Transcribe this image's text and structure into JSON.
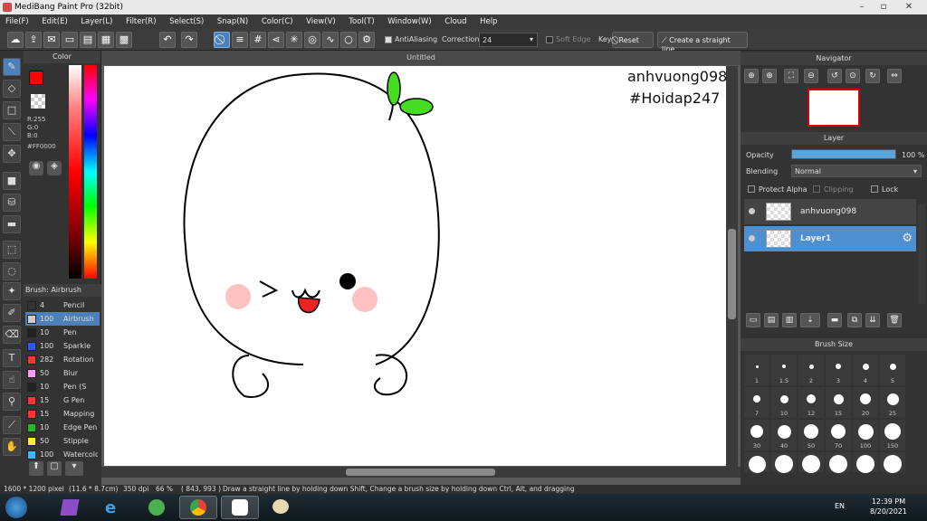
{
  "window": {
    "title": "MediBang Paint Pro (32bit)"
  },
  "menu": [
    "File(F)",
    "Edit(E)",
    "Layer(L)",
    "Filter(R)",
    "Select(S)",
    "Snap(N)",
    "Color(C)",
    "View(V)",
    "Tool(T)",
    "Window(W)",
    "Cloud",
    "Help"
  ],
  "toolbar": {
    "antialiasing_label": "AntiAliasing",
    "correction_label": "Correction",
    "correction_value": "24",
    "soft_edge_label": "Soft Edge",
    "key_label": "Key",
    "reset_label": "Reset",
    "straight_line_label": "Create a straight line"
  },
  "color_panel": {
    "title": "Color",
    "primary_color": "#FF0000",
    "r": "R:255",
    "g": "G:0",
    "b": "B:0",
    "hex": "#FF0000"
  },
  "brush_panel": {
    "title": "Brush: Airbrush",
    "brushes": [
      {
        "size": "4",
        "name": "Pencil",
        "color": "#333333"
      },
      {
        "size": "100",
        "name": "Airbrush",
        "color": "#cccccc"
      },
      {
        "size": "10",
        "name": "Pen",
        "color": "#222222"
      },
      {
        "size": "100",
        "name": "Sparkle",
        "color": "#3355ff"
      },
      {
        "size": "282",
        "name": "Rotation",
        "color": "#ff3333"
      },
      {
        "size": "50",
        "name": "Blur",
        "color": "#ff99ff"
      },
      {
        "size": "10",
        "name": "Pen (S",
        "color": "#222222"
      },
      {
        "size": "15",
        "name": "G Pen",
        "color": "#ff3333"
      },
      {
        "size": "15",
        "name": "Mapping",
        "color": "#ff3333"
      },
      {
        "size": "10",
        "name": "Edge Pen",
        "color": "#22bb22"
      },
      {
        "size": "50",
        "name": "Stipple",
        "color": "#ffee22"
      },
      {
        "size": "100",
        "name": "Watercolor",
        "color": "#33bbff"
      }
    ]
  },
  "canvas": {
    "tab_title": "Untitled",
    "watermark_line1": "anhvuong098",
    "watermark_line2": "#Hoidap247"
  },
  "navigator": {
    "title": "Navigator"
  },
  "layer_panel": {
    "title": "Layer",
    "opacity_label": "Opacity",
    "opacity_value": "100 %",
    "opacity_fraction": 1.0,
    "blending_label": "Blending",
    "blending_value": "Normal",
    "protect_alpha": "Protect Alpha",
    "clipping": "Clipping",
    "lock": "Lock",
    "layers": [
      {
        "name": "anhvuong098",
        "selected": false
      },
      {
        "name": "Layer1",
        "selected": true
      }
    ]
  },
  "brush_size_panel": {
    "title": "Brush Size",
    "sizes": [
      "1",
      "1.5",
      "2",
      "3",
      "4",
      "5",
      "7",
      "10",
      "12",
      "15",
      "20",
      "25",
      "30",
      "40",
      "50",
      "70",
      "100",
      "150",
      "",
      "",
      "",
      "",
      "",
      ""
    ]
  },
  "status": {
    "dims": "1600 * 1200 pixel",
    "physical": "(11.6 * 8.7cm)",
    "dpi": "350 dpi",
    "zoom": "66 %",
    "cursor": "( 843, 993 )",
    "hint": "Draw a straight line by holding down Shift, Change a brush size by holding down Ctrl, Alt, and dragging"
  },
  "taskbar": {
    "language": "EN",
    "time": "12:39 PM",
    "date": "8/20/2021"
  }
}
